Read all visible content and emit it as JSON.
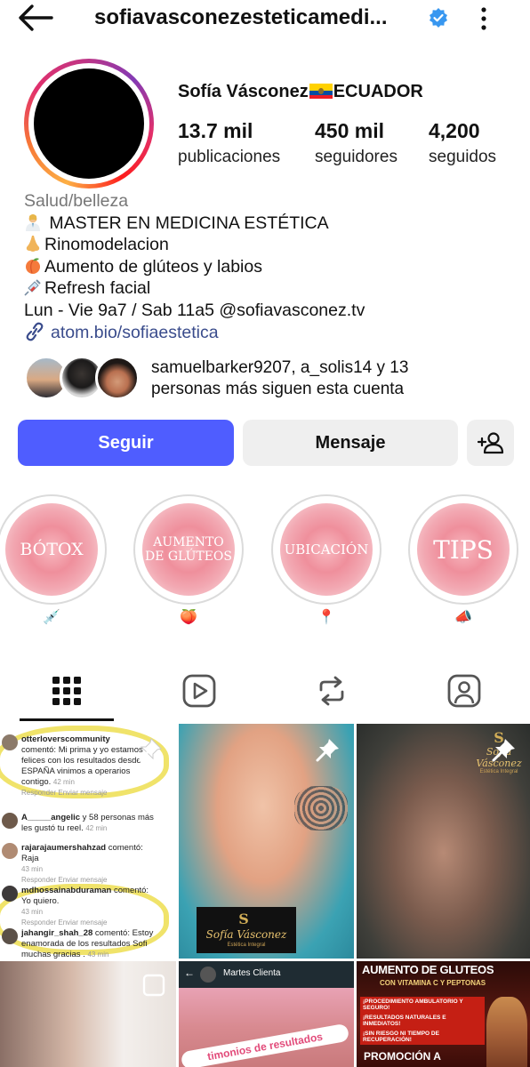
{
  "header": {
    "username": "sofiavasconezesteticamedi...",
    "back_icon": "arrow-left-icon",
    "verified_icon": "verified-badge-icon",
    "more_icon": "more-vertical-icon"
  },
  "profile": {
    "name_prefix": "Sofía Vásconez",
    "name_suffix": "ECUADOR",
    "stats": [
      {
        "value": "13.7 mil",
        "label": "publicaciones"
      },
      {
        "value": "450 mil",
        "label": "seguidores"
      },
      {
        "value": "4,200",
        "label": "seguidos"
      }
    ]
  },
  "bio": {
    "category": "Salud/belleza",
    "lines": [
      " MASTER EN MEDICINA ESTÉTICA",
      "Rinomodelacion",
      "Aumento de glúteos y labios",
      "Refresh facial",
      "Lun - Vie 9a7 / Sab 11a5 @sofiavasconez.tv"
    ],
    "link": "atom.bio/sofiaestetica"
  },
  "followed_by": {
    "text_line1": "samuelbarker9207, a_solis14 y 13",
    "text_line2": "personas más siguen esta cuenta"
  },
  "actions": {
    "follow": "Seguir",
    "message": "Mensaje"
  },
  "highlights": [
    {
      "title": "BÓTOX",
      "emoji": "💉"
    },
    {
      "title_line1": "AUMENTO",
      "title_line2": "DE GLÚTEOS",
      "emoji": "🍑"
    },
    {
      "title": "UBICACIÓN",
      "emoji": "📍"
    },
    {
      "title": "TIPS",
      "emoji": "📣"
    }
  ],
  "tabs": [
    "grid-icon",
    "reels-icon",
    "reposts-icon",
    "tagged-icon"
  ],
  "posts": {
    "comments": [
      {
        "user": "otterloverscommunity",
        "text": "comentó: Mi prima y yo estamos felices con los resultados desde ESPAÑA vinimos a operarios contigo.",
        "time": "42 min"
      },
      {
        "user": "A_____angelic",
        "text": "y 58 personas más les gustó tu reel.",
        "time": "42 min"
      },
      {
        "user": "rajarajaumershahzad",
        "text": "comentó: Raja",
        "time": "43 min"
      },
      {
        "user": "mdhossainabduraman",
        "text": "comentó: Yo quiero.",
        "time": "43 min"
      },
      {
        "user": "jahangir_shah_28",
        "text": "comentó: Estoy enamorada de los resultados Sofi muchas gracias .",
        "time": "43 min"
      }
    ],
    "comment_actions": "Responder   Enviar mensaje",
    "brand": "Sofía Vásconez",
    "brand_sub": "Estética Integral",
    "chat_name": "Martes Clienta",
    "chat_caption": "timonios de resultados",
    "promo_title": "AUMENTO DE GLUTEOS",
    "promo_sub": "CON VITAMINA C Y PEPTONAS",
    "promo_bullets": [
      "¡PROCEDIMIENTO AMBULATORIO Y SEGURO!",
      "¡RESULTADOS NATURALES E INMEDIATOS!",
      "¡SIN RIESGO NI TIEMPO DE RECUPERACIÓN!"
    ],
    "promo_bottom": "PROMOCIÓN A"
  },
  "colors": {
    "follow_button": "#4f5dff",
    "secondary_button": "#efefef",
    "link": "#3a4c8c",
    "verified": "#3897f0"
  }
}
